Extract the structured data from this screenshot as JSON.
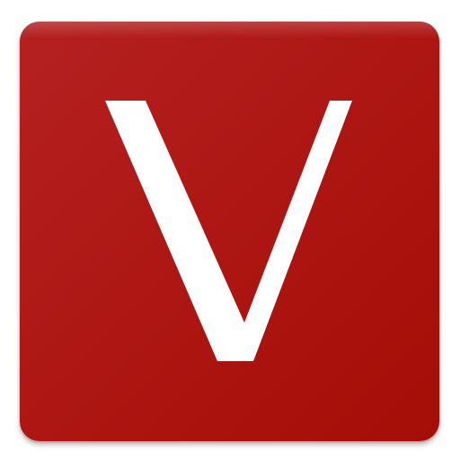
{
  "icon": {
    "letter": "V",
    "background_color": "#ad1612",
    "letter_color": "#ffffff"
  }
}
